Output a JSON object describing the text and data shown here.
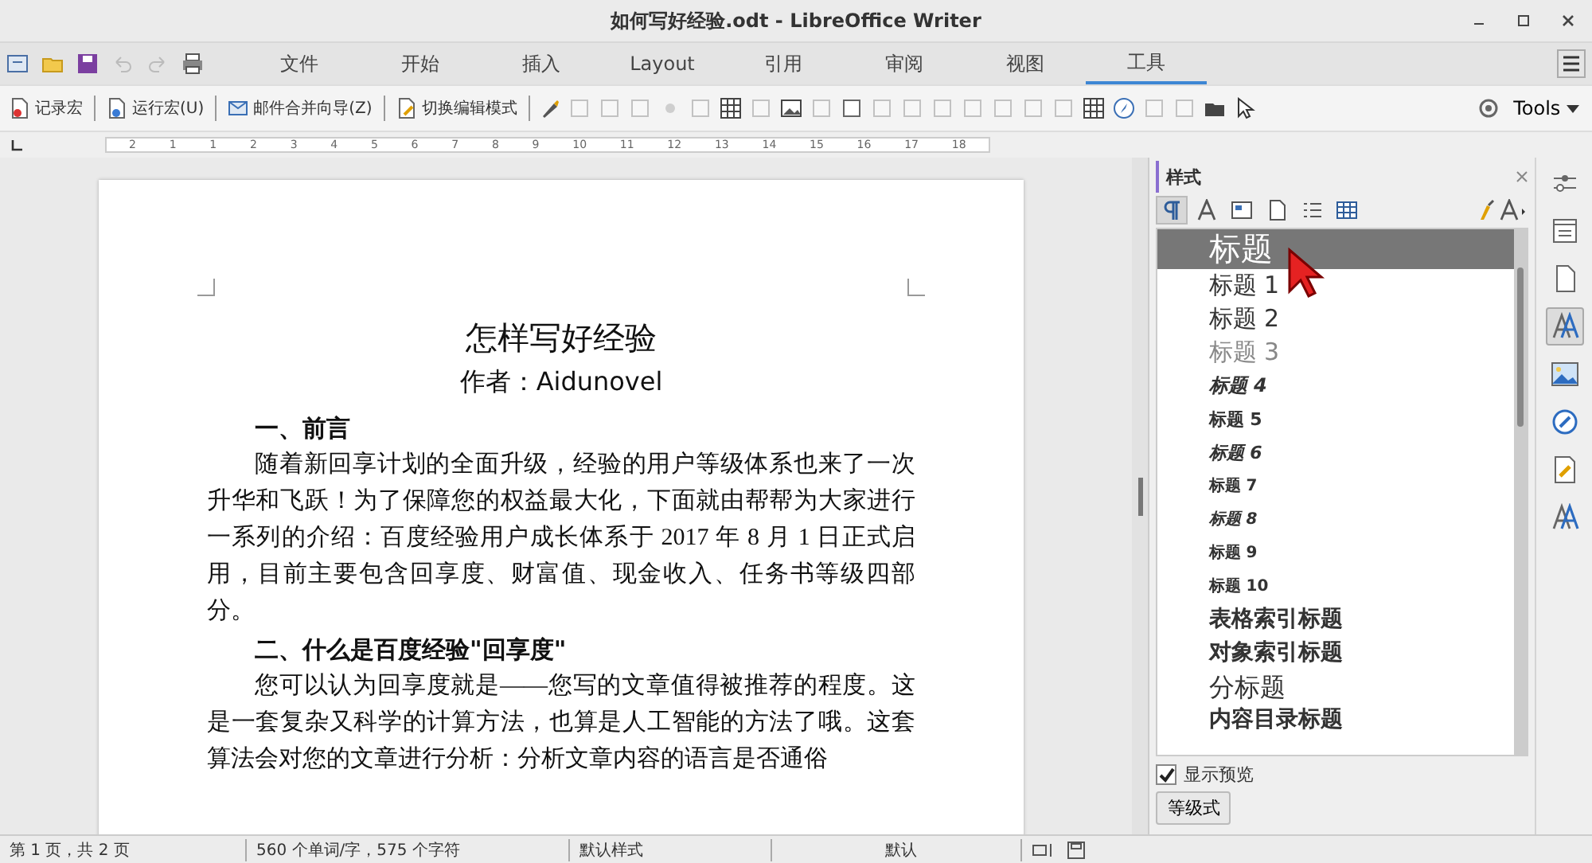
{
  "window": {
    "title": "如何写好经验.odt - LibreOffice Writer"
  },
  "tabs": [
    {
      "label": "文件",
      "selected": false
    },
    {
      "label": "开始",
      "selected": false
    },
    {
      "label": "插入",
      "selected": false
    },
    {
      "label": "Layout",
      "selected": false
    },
    {
      "label": "引用",
      "selected": false
    },
    {
      "label": "审阅",
      "selected": false
    },
    {
      "label": "视图",
      "selected": false
    },
    {
      "label": "工具",
      "selected": true
    }
  ],
  "toolbar": {
    "buttons": [
      {
        "kind": "record",
        "label": "记录宏"
      },
      {
        "kind": "run",
        "label": "运行宏(U)"
      },
      {
        "kind": "mail",
        "label": "邮件合并向导(Z)"
      },
      {
        "kind": "edit",
        "label": "切换编辑模式"
      }
    ],
    "icons": [
      {
        "kind": "brush",
        "disabled": false
      },
      {
        "kind": "square",
        "disabled": true
      },
      {
        "kind": "square",
        "disabled": true
      },
      {
        "kind": "square",
        "disabled": true
      },
      {
        "kind": "dot",
        "disabled": true
      },
      {
        "kind": "square",
        "disabled": true
      },
      {
        "kind": "table",
        "disabled": false
      },
      {
        "kind": "square",
        "disabled": true
      },
      {
        "kind": "image",
        "disabled": false
      },
      {
        "kind": "square",
        "disabled": true
      },
      {
        "kind": "square",
        "disabled": false
      },
      {
        "kind": "square",
        "disabled": true
      },
      {
        "kind": "square",
        "disabled": true
      },
      {
        "kind": "square",
        "disabled": true
      },
      {
        "kind": "square",
        "disabled": true
      },
      {
        "kind": "square",
        "disabled": true
      },
      {
        "kind": "square",
        "disabled": true
      },
      {
        "kind": "square",
        "disabled": true
      },
      {
        "kind": "table",
        "disabled": false
      },
      {
        "kind": "compass",
        "disabled": false
      },
      {
        "kind": "square",
        "disabled": true
      },
      {
        "kind": "square",
        "disabled": true
      },
      {
        "kind": "folder",
        "disabled": false
      },
      {
        "kind": "pointer",
        "disabled": false
      }
    ],
    "tools_menu": "Tools"
  },
  "ruler": {
    "labels": [
      "2",
      "1",
      "1",
      "2",
      "3",
      "4",
      "5",
      "6",
      "7",
      "8",
      "9",
      "10",
      "11",
      "12",
      "13",
      "14",
      "15",
      "16",
      "17",
      "18"
    ]
  },
  "document": {
    "title": "怎样写好经验",
    "author": "作者：Aidunovel",
    "blocks": [
      {
        "kind": "heading",
        "text": "一、前言"
      },
      {
        "kind": "paragraph",
        "text": "随着新回享计划的全面升级，经验的用户等级体系也来了一次升华和飞跃！为了保障您的权益最大化，下面就由帮帮为大家进行一系列的介绍：百度经验用户成长体系于 2017 年 8 月 1 日正式启用，目前主要包含回享度、财富值、现金收入、任务书等级四部分。"
      },
      {
        "kind": "heading",
        "text": "二、什么是百度经验\"回享度\""
      },
      {
        "kind": "paragraph",
        "text": "您可以认为回享度就是——您写的文章值得被推荐的程度。这是一套复杂又科学的计算方法，也算是人工智能的方法了哦。这套算法会对您的文章进行分析：分析文章内容的语言是否通俗"
      }
    ]
  },
  "sidebar": {
    "title": "样式",
    "categories": [
      {
        "kind": "paragraph",
        "selected": true
      },
      {
        "kind": "character",
        "selected": false
      },
      {
        "kind": "frame",
        "selected": false
      },
      {
        "kind": "page",
        "selected": false
      },
      {
        "kind": "list",
        "selected": false
      },
      {
        "kind": "table",
        "selected": false
      }
    ],
    "styles": [
      {
        "name": "标题",
        "kind": "title",
        "selected": true
      },
      {
        "name": "标题 1",
        "kind": "h-large",
        "selected": false
      },
      {
        "name": "标题 2",
        "kind": "h-large",
        "selected": false
      },
      {
        "name": "标题 3",
        "kind": "h-light",
        "selected": false
      },
      {
        "name": "标题 4",
        "kind": "h-italic",
        "selected": false
      },
      {
        "name": "标题 5",
        "kind": "h-small",
        "selected": false
      },
      {
        "name": "标题 6",
        "kind": "h-italic-small",
        "selected": false
      },
      {
        "name": "标题 7",
        "kind": "h-tiny",
        "selected": false
      },
      {
        "name": "标题 8",
        "kind": "h-italic-tiny",
        "selected": false
      },
      {
        "name": "标题 9",
        "kind": "h-tiny",
        "selected": false
      },
      {
        "name": "标题 10",
        "kind": "h-tiny",
        "selected": false
      },
      {
        "name": "表格索引标题",
        "kind": "h-bold",
        "selected": false
      },
      {
        "name": "对象索引标题",
        "kind": "h-bold",
        "selected": false
      },
      {
        "name": "分标题",
        "kind": "subtitle",
        "selected": false
      },
      {
        "name": "内容目录标题",
        "kind": "h-bold",
        "selected": false
      }
    ],
    "show_preview": {
      "label": "显示预览",
      "checked": true
    },
    "filter": "等级式",
    "deck": [
      {
        "kind": "properties",
        "selected": false
      },
      {
        "kind": "page",
        "selected": false
      },
      {
        "kind": "styles",
        "selected": true
      },
      {
        "kind": "gallery",
        "selected": false
      },
      {
        "kind": "navigator",
        "selected": false
      },
      {
        "kind": "manage",
        "selected": false
      },
      {
        "kind": "styles2",
        "selected": false
      }
    ]
  },
  "status_bar": {
    "page": "第 1 页，共 2 页",
    "words": "560 个单词/字，575 个字符",
    "page_style": "默认样式",
    "language": "默认"
  }
}
